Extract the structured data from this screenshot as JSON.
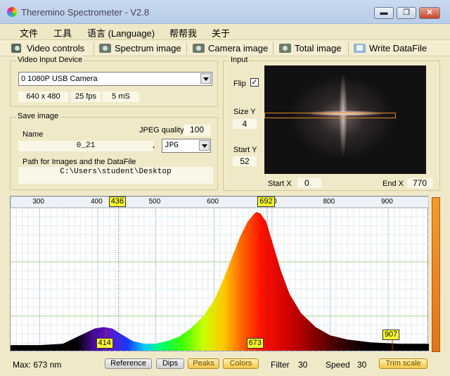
{
  "window": {
    "title": "Theremino Spectrometer - V2.8",
    "minimize": "▬",
    "maximize": "❐",
    "close": "✕"
  },
  "menu": [
    "文件",
    "工具",
    "语言 (Language)",
    "帮帮我",
    "关于"
  ],
  "toolbar": [
    "Video controls",
    "Spectrum image",
    "Camera image",
    "Total image",
    "Write DataFile"
  ],
  "video_input": {
    "label": "Video Input Device",
    "device": "0 1080P USB Camera",
    "resolution": "640 x 480",
    "fps": "25 fps",
    "exposure": "5 mS"
  },
  "save_image": {
    "label": "Save image",
    "name_label": "Name",
    "name_value": "0_21",
    "dot": ".",
    "jpeg_quality_label": "JPEG quality",
    "jpeg_quality_value": "100",
    "format": "JPG",
    "path_label": "Path for Images and the DataFile",
    "path_value": "C:\\Users\\student\\Desktop"
  },
  "input": {
    "label": "Input",
    "flip_label": "Flip",
    "flip_checked": "✓",
    "size_y_label": "Size Y",
    "size_y_value": "4",
    "start_y_label": "Start Y",
    "start_y_value": "52",
    "start_x_label": "Start X",
    "start_x_value": "0",
    "end_x_label": "End X",
    "end_x_value": "770"
  },
  "spectrum": {
    "axis_ticks": [
      "300",
      "400",
      "500",
      "600",
      "700",
      "800",
      "900"
    ],
    "marker_top_left": "436",
    "marker_top_right": "692",
    "peak_labels": [
      "414",
      "673",
      "907"
    ]
  },
  "status": {
    "max_label": "Max: 673 nm",
    "buttons": [
      "Reference",
      "Dips",
      "Peaks",
      "Colors"
    ],
    "filter_label": "Filter",
    "filter_value": "30",
    "speed_label": "Speed",
    "speed_value": "30",
    "trim_label": "Trim scale"
  },
  "chart_data": {
    "type": "area",
    "x_unit": "nm",
    "xlim": [
      250,
      970
    ],
    "ylim": [
      0,
      1
    ],
    "ticks": [
      300,
      400,
      500,
      600,
      700,
      800,
      900
    ],
    "points": [
      [
        250,
        0.04
      ],
      [
        300,
        0.04
      ],
      [
        340,
        0.05
      ],
      [
        360,
        0.09
      ],
      [
        375,
        0.12
      ],
      [
        395,
        0.16
      ],
      [
        410,
        0.17
      ],
      [
        425,
        0.16
      ],
      [
        440,
        0.12
      ],
      [
        460,
        0.07
      ],
      [
        480,
        0.05
      ],
      [
        500,
        0.05
      ],
      [
        520,
        0.07
      ],
      [
        540,
        0.1
      ],
      [
        560,
        0.16
      ],
      [
        580,
        0.24
      ],
      [
        600,
        0.36
      ],
      [
        615,
        0.5
      ],
      [
        630,
        0.66
      ],
      [
        645,
        0.82
      ],
      [
        658,
        0.93
      ],
      [
        668,
        0.98
      ],
      [
        673,
        1.0
      ],
      [
        680,
        0.99
      ],
      [
        690,
        0.93
      ],
      [
        700,
        0.79
      ],
      [
        715,
        0.58
      ],
      [
        730,
        0.41
      ],
      [
        750,
        0.27
      ],
      [
        775,
        0.17
      ],
      [
        800,
        0.11
      ],
      [
        830,
        0.08
      ],
      [
        870,
        0.06
      ],
      [
        920,
        0.05
      ],
      [
        970,
        0.05
      ]
    ],
    "markers": [
      436,
      692
    ],
    "peaks": [
      414,
      673,
      907
    ]
  }
}
